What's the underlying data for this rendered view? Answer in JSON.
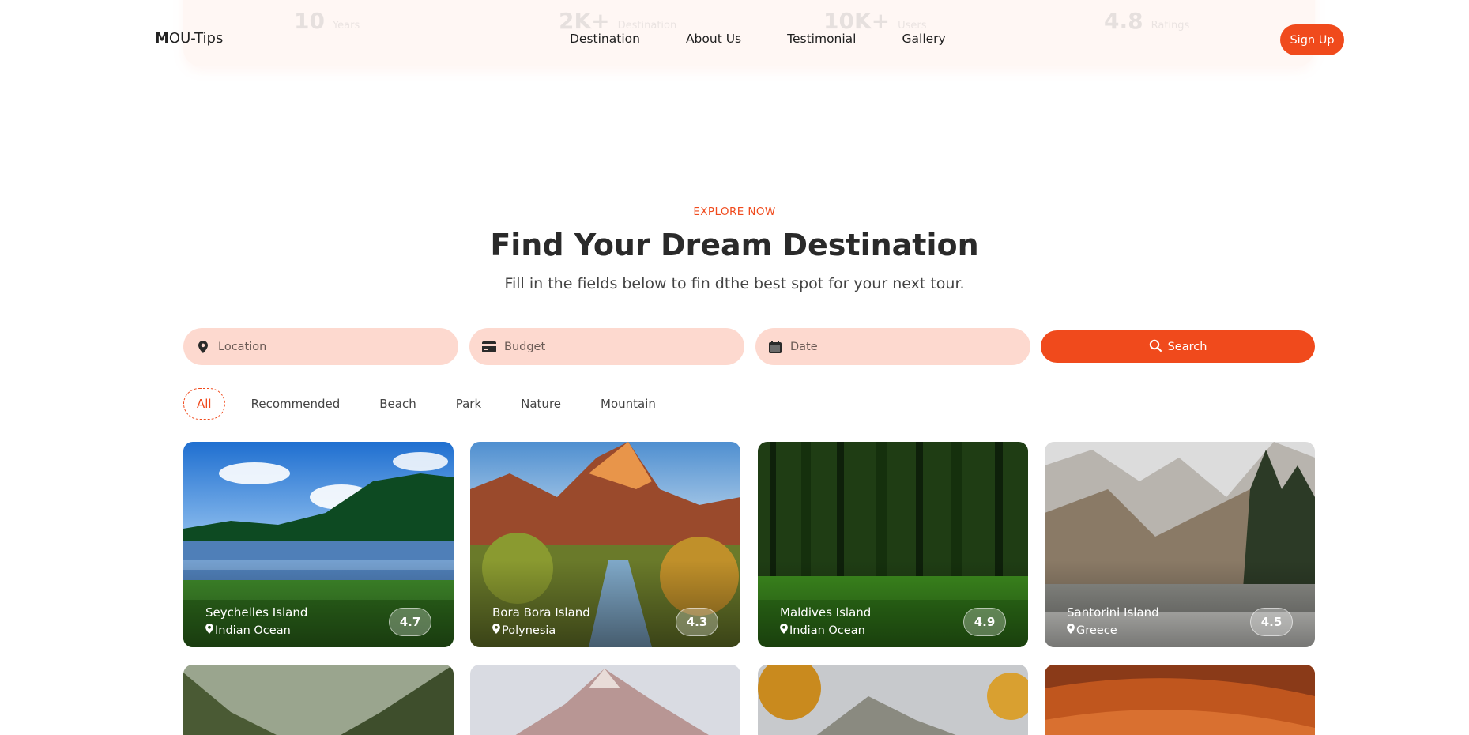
{
  "brand": {
    "logo_mark": "M",
    "logo_text": "OU-Tips"
  },
  "stats_bar": [
    {
      "num": "10",
      "label": "Years"
    },
    {
      "num": "2K+",
      "label": "Destination"
    },
    {
      "num": "10K+",
      "label": "Users"
    },
    {
      "num": "4.8",
      "label": "Ratings"
    }
  ],
  "nav": {
    "items": [
      "Destination",
      "About Us",
      "Testimonial",
      "Gallery"
    ],
    "signup_label": "Sign Up"
  },
  "hero": {
    "eyebrow": "EXPLORE NOW",
    "title": "Find Your Dream Destination",
    "subtitle": "Fill in the fields below to fin dthe best spot for your next tour."
  },
  "search": {
    "location_placeholder": "Location",
    "budget_placeholder": "Budget",
    "date_placeholder": "Date",
    "button_label": "Search"
  },
  "filters": {
    "items": [
      "All",
      "Recommended",
      "Beach",
      "Park",
      "Nature",
      "Mountain"
    ],
    "active": "All"
  },
  "destinations": [
    {
      "name": "Seychelles Island",
      "location": "Indian Ocean",
      "rating": "4.7"
    },
    {
      "name": "Bora Bora Island",
      "location": "Polynesia",
      "rating": "4.3"
    },
    {
      "name": "Maldives Island",
      "location": "Indian Ocean",
      "rating": "4.9"
    },
    {
      "name": "Santorini Island",
      "location": "Greece",
      "rating": "4.5"
    }
  ],
  "colors": {
    "accent": "#f04a1c",
    "field_bg": "#fdd9cf"
  }
}
